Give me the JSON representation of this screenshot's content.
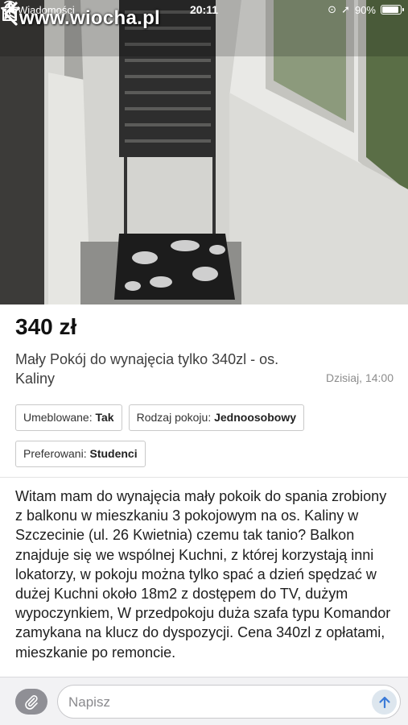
{
  "status_bar": {
    "back_app": "Wiadomości",
    "time": "20:11",
    "battery": "90%",
    "battery_level": 0.9
  },
  "watermark": "www.wiocha.pl",
  "icons": {
    "back": "chevron-left-icon",
    "favorite": "star-outline-icon",
    "share": "share-icon",
    "attach": "paperclip-icon",
    "send": "arrow-up-icon"
  },
  "listing": {
    "price": "340 zł",
    "title": "Mały Pokój do wynajęcia tylko 340zl - os. Kaliny",
    "date": "Dzisiaj, 14:00",
    "params": [
      {
        "label": "Umeblowane:",
        "value": "Tak"
      },
      {
        "label": "Rodzaj pokoju:",
        "value": "Jednoosobowy"
      },
      {
        "label": "Preferowani:",
        "value": "Studenci"
      }
    ],
    "description": "Witam mam do wynajęcia mały pokoik do spania zrobiony z balkonu w mieszkaniu 3 pokojowym na os. Kaliny w Szczecinie (ul. 26 Kwietnia) czemu tak tanio? Balkon znajduje się we wspólnej Kuchni, z której korzystają inni lokatorzy, w pokoju można tylko spać a dzień spędzać w dużej Kuchni około 18m2 z dostępem do TV, dużym wypoczynkiem, W przedpokoju duża szafa typu Komandor zamykana na klucz do dyspozycji. Cena 340zl z opłatami, mieszkanie po remoncie."
  },
  "message_bar": {
    "placeholder": "Napisz"
  },
  "colors": {
    "accent_send": "#3b7bd8",
    "attach_bg": "#8f8f95"
  }
}
